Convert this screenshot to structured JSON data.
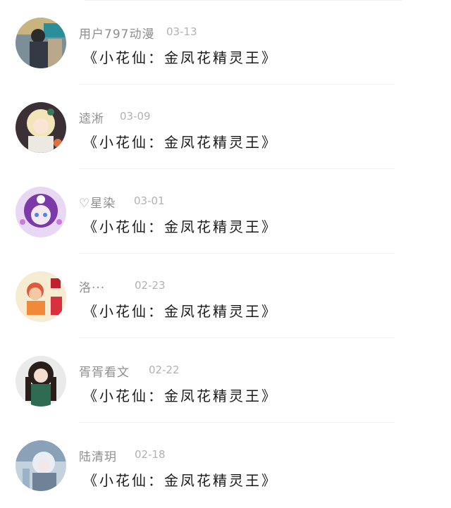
{
  "comments": [
    {
      "name": "用户797动漫",
      "time": "03-13",
      "text": "《小花仙：金凤花精灵王》"
    },
    {
      "name": "逵淅",
      "time": "03-09",
      "text": "《小花仙：金凤花精灵王》"
    },
    {
      "name": "♡星染",
      "time": "03-01",
      "text": "《小花仙：金凤花精灵王》"
    },
    {
      "name": "洛···",
      "time": "02-23",
      "text": "《小花仙：金凤花精灵王》"
    },
    {
      "name": "胥胥看文",
      "time": "02-22",
      "text": "《小花仙：金凤花精灵王》"
    },
    {
      "name": "陆清玥",
      "time": "02-18",
      "text": "《小花仙：金凤花精灵王》"
    }
  ],
  "avatar_colors": [
    "#5a6e7a",
    "#c8d8e0",
    "#9a6ad0",
    "#f0d090",
    "#2e4a3a",
    "#b0c4d8"
  ]
}
